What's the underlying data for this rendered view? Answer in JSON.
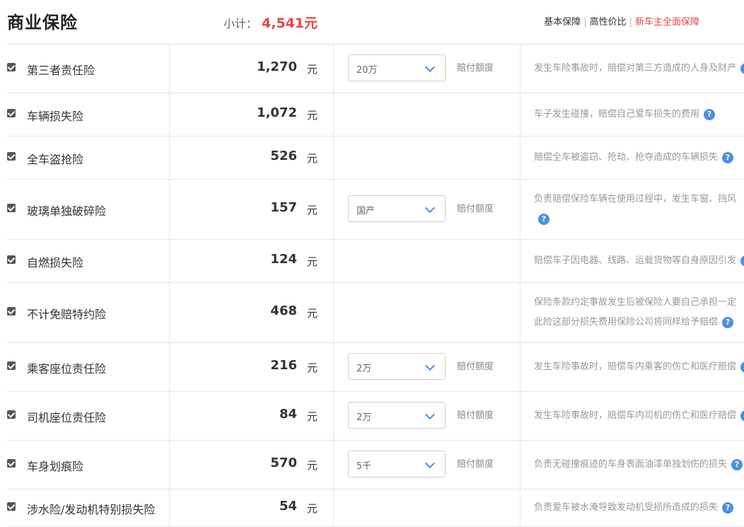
{
  "header": {
    "title": "商业保险",
    "subtotal_label": "小计：",
    "subtotal_value": "4,541元",
    "plans": [
      "基本保障",
      "高性价比",
      "新车主全面保障"
    ]
  },
  "rows": [
    {
      "checked": true,
      "name": "第三者责任险",
      "price": "1,270",
      "unit": "元",
      "select": "20万",
      "amount_label": "赔付额度",
      "desc": [
        "发生车险事故时，赔偿对第三方造成的人身及财产"
      ]
    },
    {
      "checked": true,
      "name": "车辆损失险",
      "price": "1,072",
      "unit": "元",
      "select": null,
      "amount_label": null,
      "desc": [
        "车子发生碰撞，赔偿自己爱车损失的费用"
      ]
    },
    {
      "checked": true,
      "name": "全车盗抢险",
      "price": "526",
      "unit": "元",
      "select": null,
      "amount_label": null,
      "desc": [
        "赔偿全车被盗窃、抢劫、抢夺造成的车辆损失"
      ]
    },
    {
      "checked": true,
      "name": "玻璃单独破碎险",
      "price": "157",
      "unit": "元",
      "select": "国产",
      "amount_label": "赔付额度",
      "desc": [
        "负责赔偿保险车辆在使用过程中，发生车窗、挡风",
        ""
      ]
    },
    {
      "checked": true,
      "name": "自燃损失险",
      "price": "124",
      "unit": "元",
      "select": null,
      "amount_label": null,
      "desc": [
        "赔偿车子因电器、线路、运载货物等自身原因引发"
      ]
    },
    {
      "checked": true,
      "name": "不计免赔特约险",
      "price": "468",
      "unit": "元",
      "select": null,
      "amount_label": null,
      "desc": [
        "保险条款约定事故发生后被保险人要自己承担一定",
        "此险这部分损失费用保险公司将同样给予赔偿"
      ]
    },
    {
      "checked": true,
      "name": "乘客座位责任险",
      "price": "216",
      "unit": "元",
      "select": "2万",
      "amount_label": "赔付额度",
      "desc": [
        "发生车险事故时，赔偿车内乘客的伤亡和医疗赔偿"
      ]
    },
    {
      "checked": true,
      "name": "司机座位责任险",
      "price": "84",
      "unit": "元",
      "select": "2万",
      "amount_label": "赔付额度",
      "desc": [
        "发生车险事故时，赔偿车内司机的伤亡和医疗赔偿"
      ]
    },
    {
      "checked": true,
      "name": "车身划痕险",
      "price": "570",
      "unit": "元",
      "select": "5千",
      "amount_label": "赔付额度",
      "desc": [
        "负责无碰撞痕迹的车身表面油漆单独划伤的损失"
      ]
    },
    {
      "checked": true,
      "name": "涉水险/发动机特别损失险",
      "price": "54",
      "unit": "元",
      "select": null,
      "amount_label": null,
      "desc": [
        "负责爱车被水淹导致发动机受损所造成的损失"
      ]
    }
  ],
  "icons": {
    "help": "question-icon",
    "check": "checkbox-icon",
    "dropdown": "chevron-down-icon"
  },
  "colors": {
    "accent": "#e64545",
    "link": "#4a90e2"
  }
}
